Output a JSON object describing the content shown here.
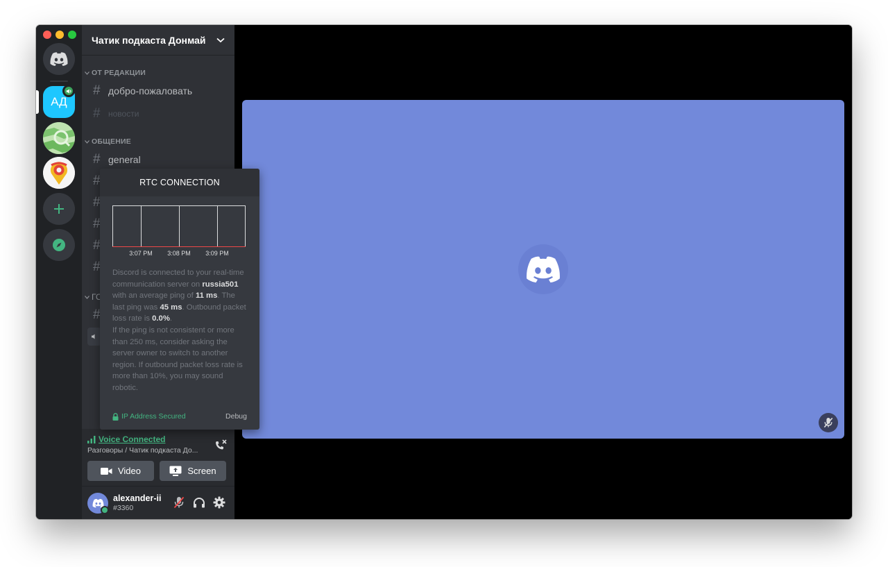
{
  "colors": {
    "blurple": "#7289da",
    "green": "#43b581",
    "ad_server": "#1ec7ff",
    "graph_baseline": "#f04747"
  },
  "rail": {
    "home_icon": "discord-icon",
    "ad_server_label": "АД",
    "add_icon": "plus-icon",
    "explore_icon": "compass-icon"
  },
  "server": {
    "name": "Чатик подкаста Донмай",
    "dropdown_icon": "chevron-down-icon"
  },
  "categories": [
    {
      "name": "ОТ РЕДАКЦИИ",
      "channels": [
        {
          "name": "добро-пожаловать"
        },
        {
          "name": "новости"
        }
      ]
    },
    {
      "name": "ОБЩЕНИЕ",
      "channels": [
        {
          "name": "general"
        }
      ]
    },
    {
      "name": "ГО"
    }
  ],
  "voice": {
    "status": "Voice Connected",
    "location": "Разговоры / Чатик подкаста До...",
    "video_label": "Video",
    "screen_label": "Screen"
  },
  "user": {
    "name": "alexander-ii",
    "tag": "#3360"
  },
  "rtc": {
    "title": "RTC CONNECTION",
    "ticks": [
      "3:07 PM",
      "3:08 PM",
      "3:09 PM"
    ],
    "p1": "Discord is connected to your real-time communication server on",
    "server": "russia501",
    "p2": "with an average ping of",
    "avg_ping": "11 ms",
    "p3": ". The last ping was",
    "last_ping": "45 ms",
    "p4": ". Outbound packet loss rate is",
    "loss": "0.0%",
    "p5": ".",
    "advice": "If the ping is not consistent or more than 250 ms, consider asking the server owner to switch to another region. If outbound packet loss rate is more than 10%, you may sound robotic.",
    "secured": "IP Address Secured",
    "debug": "Debug"
  }
}
